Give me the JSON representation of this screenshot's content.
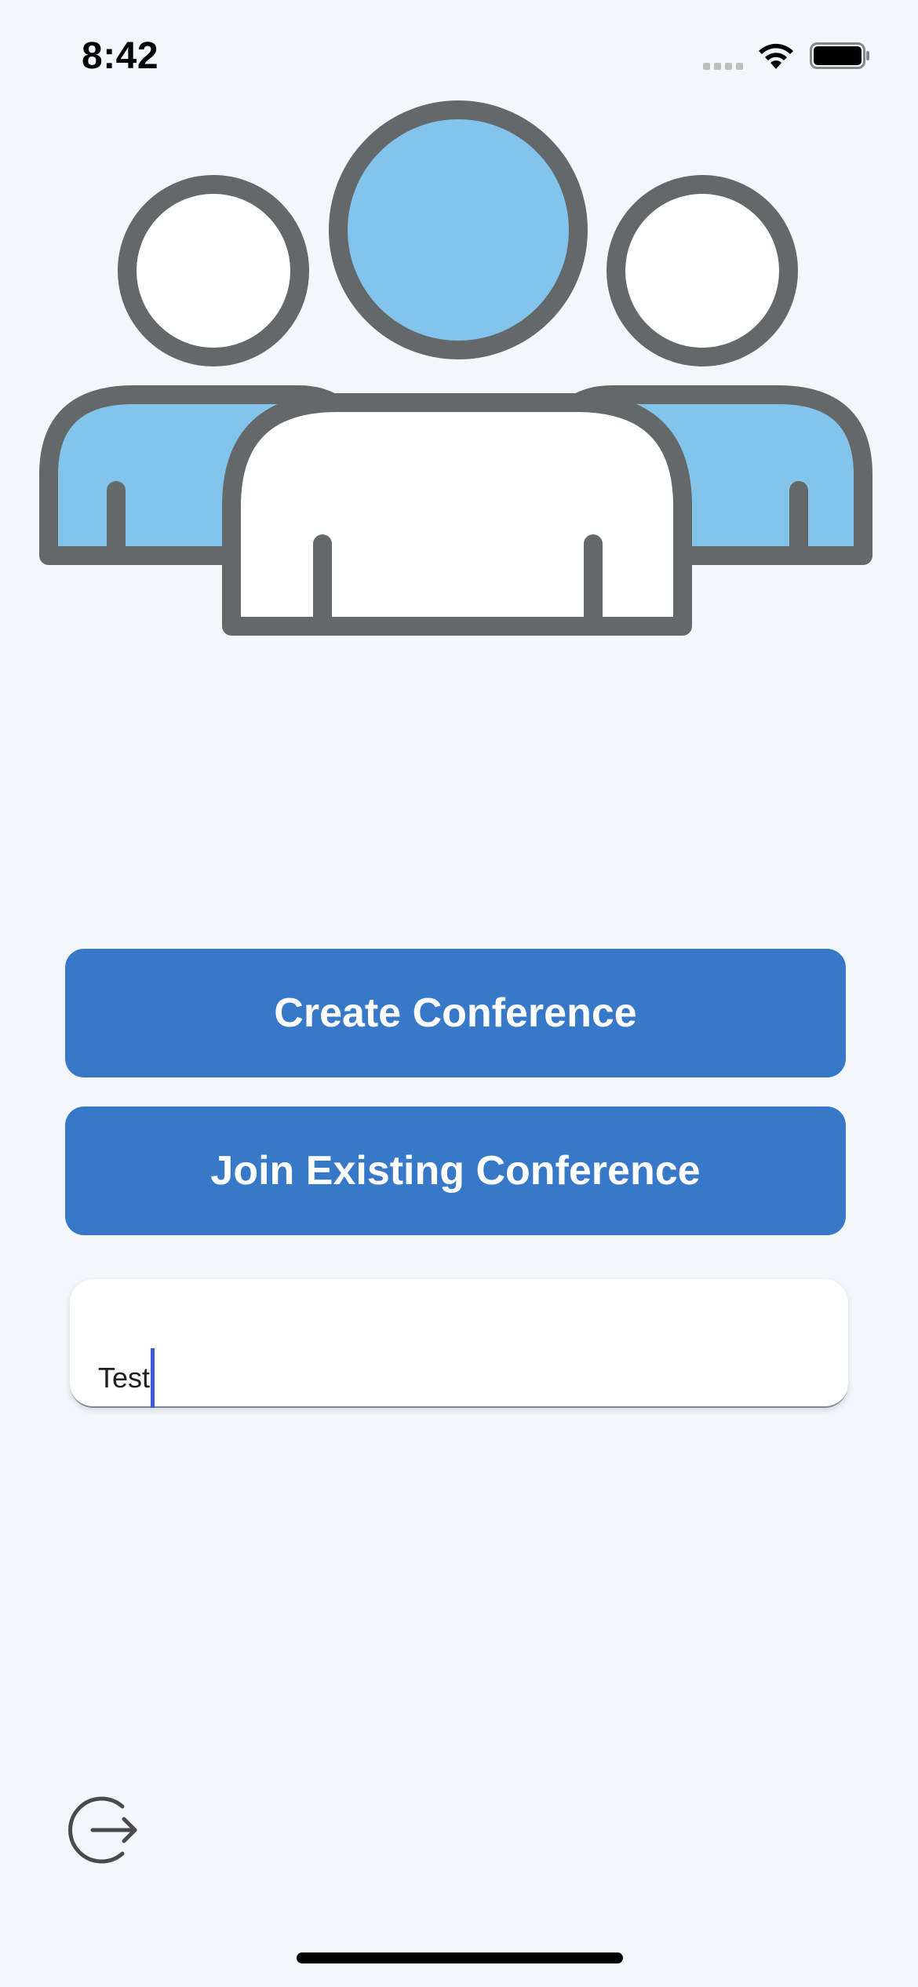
{
  "status_bar": {
    "time": "8:42"
  },
  "illustration": {
    "name": "people-group-icon",
    "stroke_color": "#646868",
    "fill_color": "#82c4ec"
  },
  "actions": {
    "create_label": "Create Conference",
    "join_label": "Join Existing Conference"
  },
  "conference_field": {
    "value": "Test"
  },
  "colors": {
    "button": "#3878c8",
    "background": "#f3f6fb",
    "caret": "#3b5bdb"
  },
  "icons": {
    "logout": "logout-icon"
  }
}
